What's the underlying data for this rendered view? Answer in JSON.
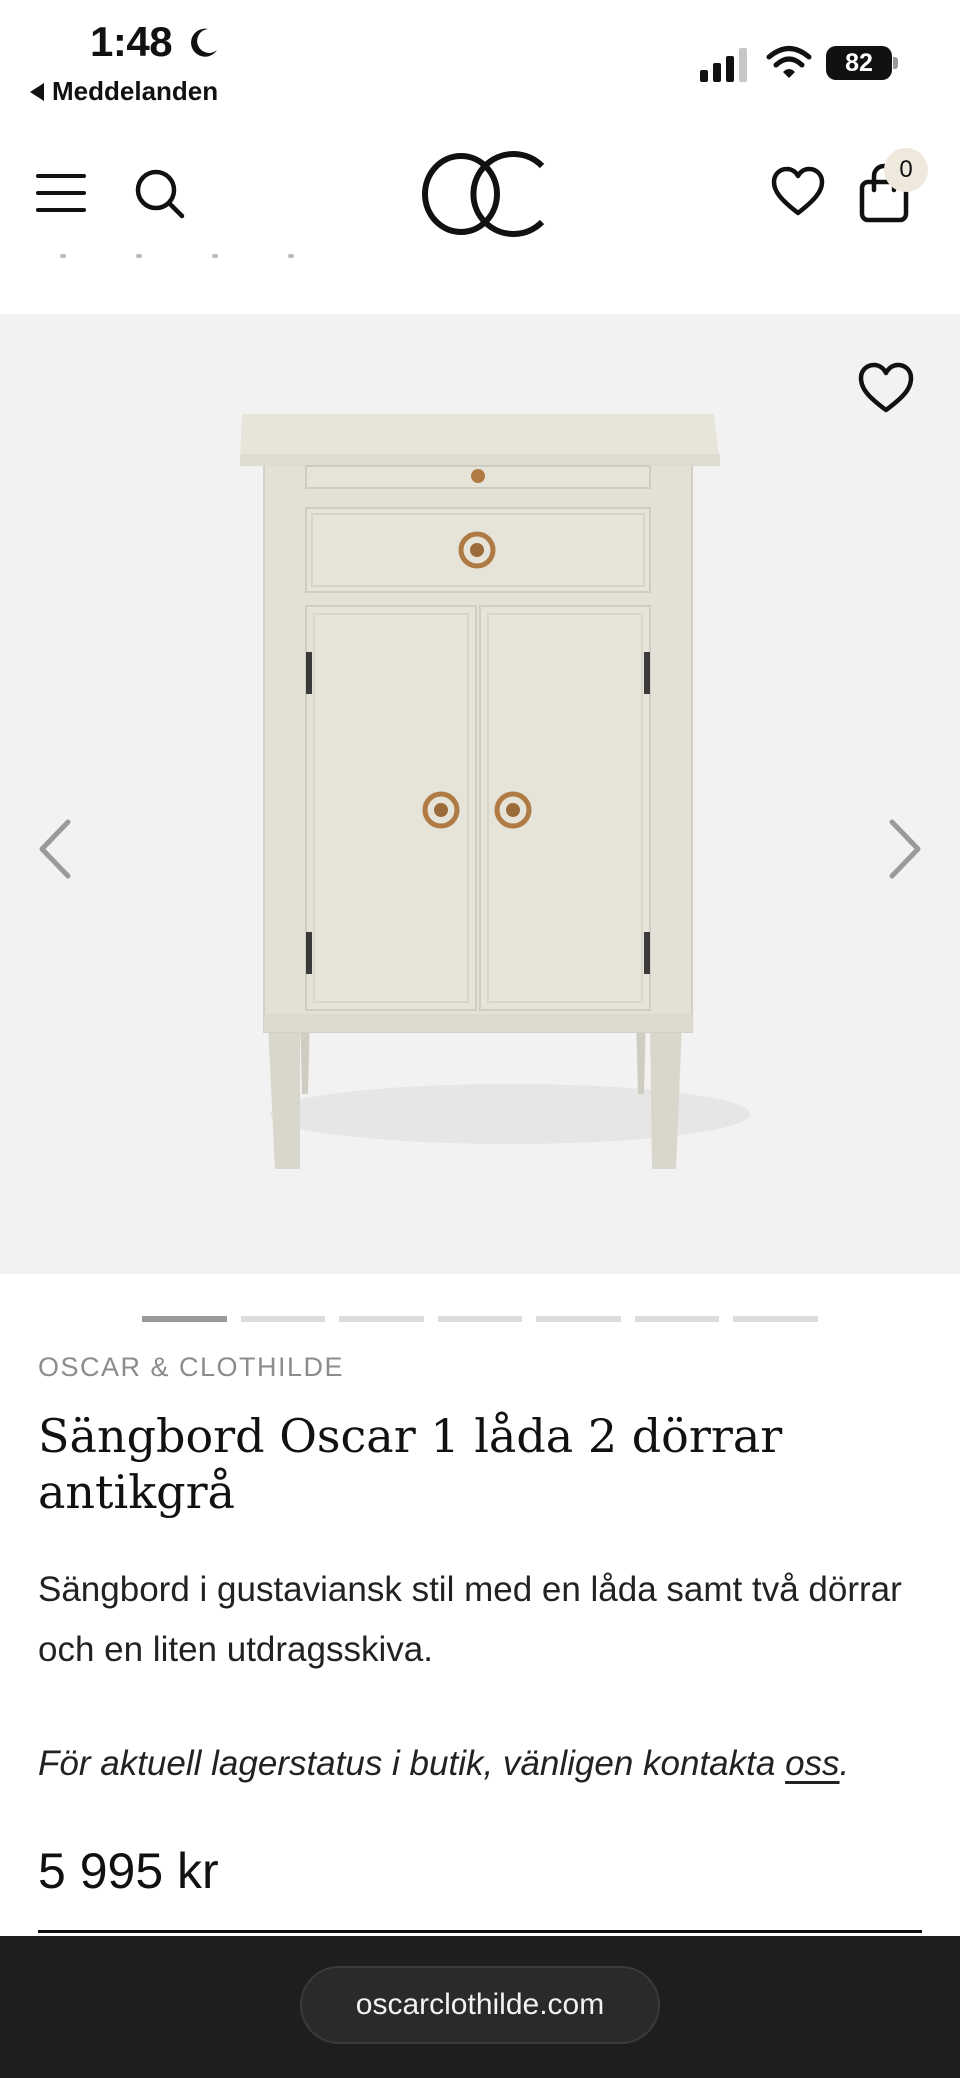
{
  "status_bar": {
    "time": "1:48",
    "back_app": "Meddelanden",
    "battery": "82"
  },
  "header": {
    "logo_text": "OC",
    "cart_count": "0"
  },
  "gallery": {
    "image_count": 7,
    "active_index": 0
  },
  "product": {
    "brand": "OSCAR & CLOTHILDE",
    "title": "Sängbord Oscar 1 låda 2 dörrar antikgrå",
    "description": "Sängbord i gustaviansk stil med en låda samt två dörrar och en liten utdragsskiva.",
    "stock_note": "För aktuell lagerstatus i butik, vänligen kontakta ",
    "stock_link": "oss",
    "stock_end": ".",
    "price": "5 995 kr"
  },
  "browser": {
    "url": "oscarclothilde.com"
  },
  "colors": {
    "gallery_bg": "#f2f2f2",
    "cabinet": "#e3e0d6",
    "brass": "#b07a44",
    "badge_bg": "#efe8dd",
    "browser_bg": "#1e1e1e"
  },
  "icons": [
    "moon-icon",
    "signal-icon",
    "wifi-icon",
    "menu-icon",
    "search-icon",
    "heart-icon",
    "bag-icon",
    "chevron-left-icon",
    "chevron-right-icon"
  ]
}
